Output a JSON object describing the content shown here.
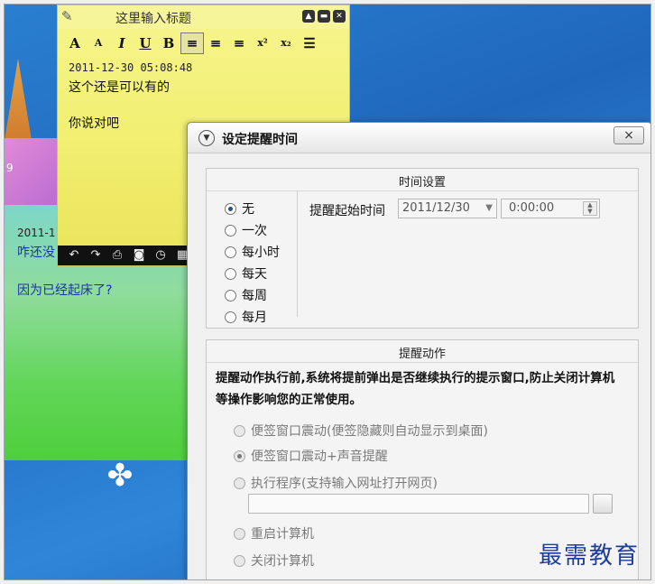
{
  "note_yellow": {
    "title": "这里输入标题",
    "timestamp": "2011-12-30 05:08:48",
    "line1": "这个还是可以有的",
    "line2": "你说对吧",
    "format_buttons": [
      "A",
      "A",
      "I",
      "U",
      "B",
      "≡",
      "≡",
      "≡",
      "x²",
      "x₂",
      "☰"
    ]
  },
  "note_green": {
    "time_partial": "2011-1",
    "line1_partial": "咋还没",
    "line2": "因为已经起床了?"
  },
  "desktop": {
    "side_number": "9"
  },
  "dialog": {
    "title": "设定提醒时间",
    "close_label": "×",
    "time_group": {
      "title": "时间设置",
      "options": [
        "无",
        "一次",
        "每小时",
        "每天",
        "每周",
        "每月"
      ],
      "selected": "无",
      "start_label": "提醒起始时间",
      "date_value": "2011/12/30",
      "time_value": "0:00:00"
    },
    "action_group": {
      "title": "提醒动作",
      "description": "提醒动作执行前,系统将提前弹出是否继续执行的提示窗口,防止关闭计算机等操作影响您的正常使用。",
      "options": [
        "便签窗口震动(便签隐藏则自动显示到桌面)",
        "便签窗口震动+声音提醒",
        "执行程序(支持输入网址打开网页)",
        "重启计算机",
        "关闭计算机"
      ],
      "selected": "便签窗口震动+声音提醒",
      "program_path": ""
    }
  },
  "watermark": "最需教育"
}
